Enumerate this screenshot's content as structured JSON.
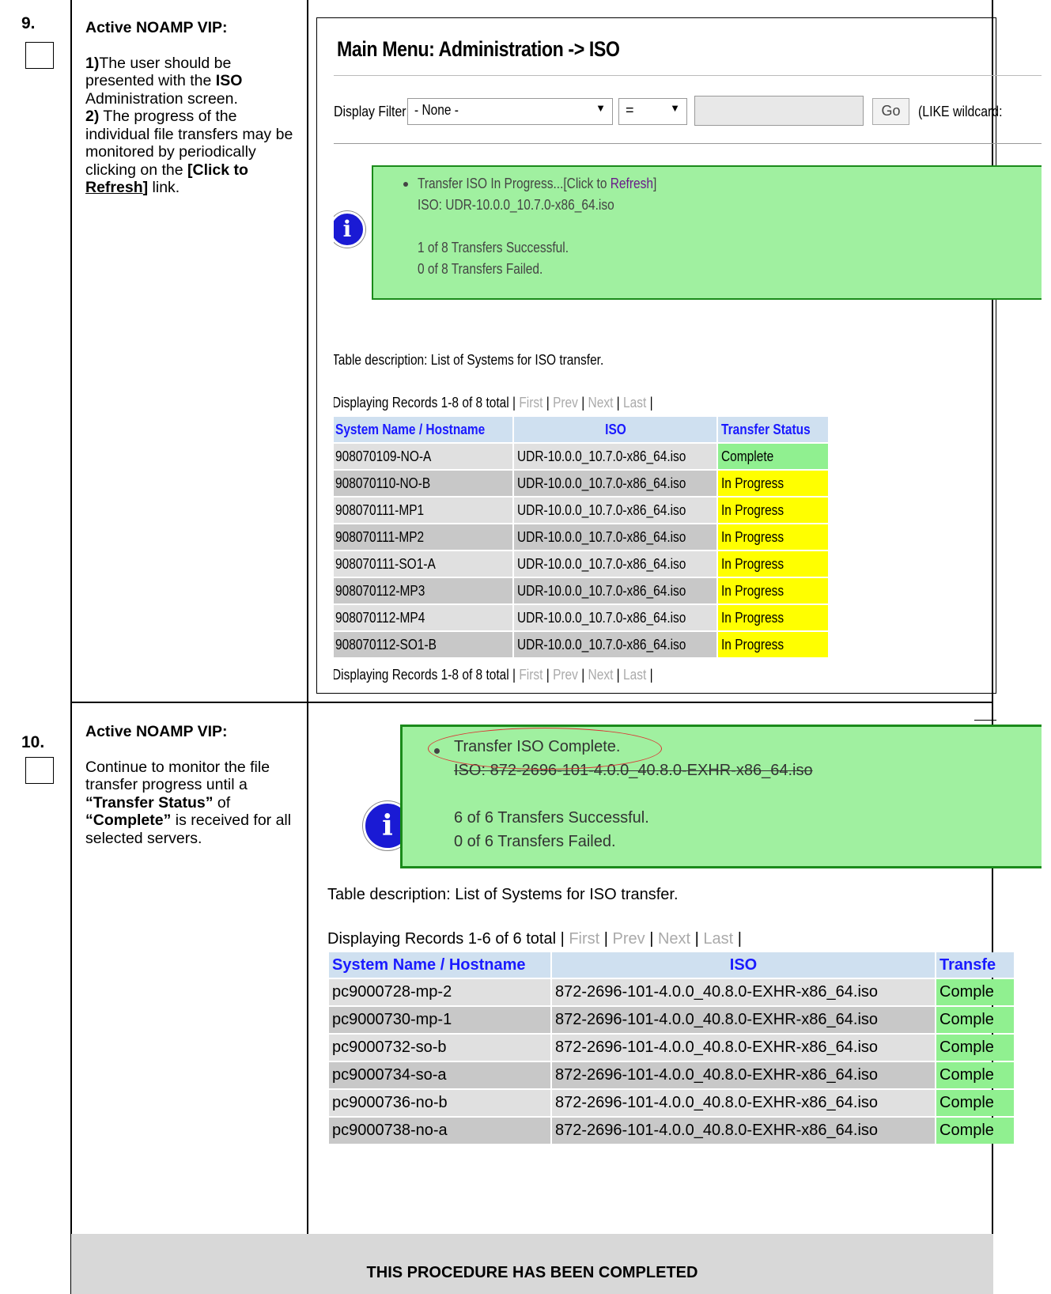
{
  "step9": {
    "number": "9.",
    "heading": "Active NOAMP VIP:",
    "desc": {
      "p1_num": "1)",
      "p1_a": "The user should be presented with the ",
      "p1_b": "ISO",
      "p1_c": " Administration screen.",
      "p2_num": "2)",
      "p2_a": " The progress of the individual file transfers may be monitored by periodically clicking on the ",
      "p2_link_open": "[Click to ",
      "p2_link": "Refresh",
      "p2_link_close": "]",
      "p2_end": " link."
    },
    "screen": {
      "title": "Main Menu: Administration -> ISO",
      "filter_label": "Display Filter:",
      "filter_value": "- None -",
      "operator_value": "=",
      "go_label": "Go",
      "like_text": "(LIKE wildcard:",
      "message": {
        "line1": "Transfer ISO In Progress...[Click to ",
        "refresh": "Refresh",
        "line1_end": "]",
        "iso": "ISO:  UDR-10.0.0_10.7.0-x86_64.iso",
        "success": "1 of 8 Transfers Successful.",
        "failed": "0 of 8 Transfers Failed."
      },
      "table_desc": "Table description: List of Systems for ISO transfer.",
      "records": "Displaying Records 1-8 of 8 total | ",
      "nav": {
        "first": "First",
        "prev": "Prev",
        "next": "Next",
        "last": "Last"
      },
      "columns": [
        "System Name / Hostname",
        "ISO",
        "Transfer Status"
      ],
      "rows": [
        {
          "host": "908070109-NO-A",
          "iso": "UDR-10.0.0_10.7.0-x86_64.iso",
          "status": "Complete"
        },
        {
          "host": "908070110-NO-B",
          "iso": "UDR-10.0.0_10.7.0-x86_64.iso",
          "status": "In Progress"
        },
        {
          "host": "908070111-MP1",
          "iso": "UDR-10.0.0_10.7.0-x86_64.iso",
          "status": "In Progress"
        },
        {
          "host": "908070111-MP2",
          "iso": "UDR-10.0.0_10.7.0-x86_64.iso",
          "status": "In Progress"
        },
        {
          "host": "908070111-SO1-A",
          "iso": "UDR-10.0.0_10.7.0-x86_64.iso",
          "status": "In Progress"
        },
        {
          "host": "908070112-MP3",
          "iso": "UDR-10.0.0_10.7.0-x86_64.iso",
          "status": "In Progress"
        },
        {
          "host": "908070112-MP4",
          "iso": "UDR-10.0.0_10.7.0-x86_64.iso",
          "status": "In Progress"
        },
        {
          "host": "908070112-SO1-B",
          "iso": "UDR-10.0.0_10.7.0-x86_64.iso",
          "status": "In Progress"
        }
      ]
    }
  },
  "step10": {
    "number": "10.",
    "heading": "Active NOAMP VIP:",
    "desc": {
      "a": "Continue to monitor the file transfer progress until a ",
      "b": "“Transfer Status”",
      "c": " of ",
      "d": "“Complete”",
      "e": " is received for all selected servers."
    },
    "screen": {
      "message": {
        "line1": "Transfer ISO Complete.",
        "iso": "ISO:  872-2696-101-4.0.0_40.8.0-EXHR-x86_64.iso",
        "success": "6 of 6 Transfers Successful.",
        "failed": "0 of 6 Transfers Failed."
      },
      "table_desc": "Table description: List of Systems for ISO transfer.",
      "records": "Displaying Records 1-6 of 6 total | ",
      "nav": {
        "first": "First",
        "prev": "Prev",
        "next": "Next",
        "last": "Last"
      },
      "columns": [
        "System Name / Hostname",
        "ISO",
        "Transfe"
      ],
      "rows": [
        {
          "host": "pc9000728-mp-2",
          "iso": "872-2696-101-4.0.0_40.8.0-EXHR-x86_64.iso",
          "status": "Comple"
        },
        {
          "host": "pc9000730-mp-1",
          "iso": "872-2696-101-4.0.0_40.8.0-EXHR-x86_64.iso",
          "status": "Comple"
        },
        {
          "host": "pc9000732-so-b",
          "iso": "872-2696-101-4.0.0_40.8.0-EXHR-x86_64.iso",
          "status": "Comple"
        },
        {
          "host": "pc9000734-so-a",
          "iso": "872-2696-101-4.0.0_40.8.0-EXHR-x86_64.iso",
          "status": "Comple"
        },
        {
          "host": "pc9000736-no-b",
          "iso": "872-2696-101-4.0.0_40.8.0-EXHR-x86_64.iso",
          "status": "Comple"
        },
        {
          "host": "pc9000738-no-a",
          "iso": "872-2696-101-4.0.0_40.8.0-EXHR-x86_64.iso",
          "status": "Comple"
        }
      ]
    }
  },
  "footer": "THIS PROCEDURE HAS BEEN COMPLETED",
  "colors": {
    "complete": "#90f090",
    "in_progress": "#ffff00",
    "header_blue": "#1a1aff",
    "message_green": "#a0f0a0",
    "info_blue": "#1a1ad4"
  }
}
